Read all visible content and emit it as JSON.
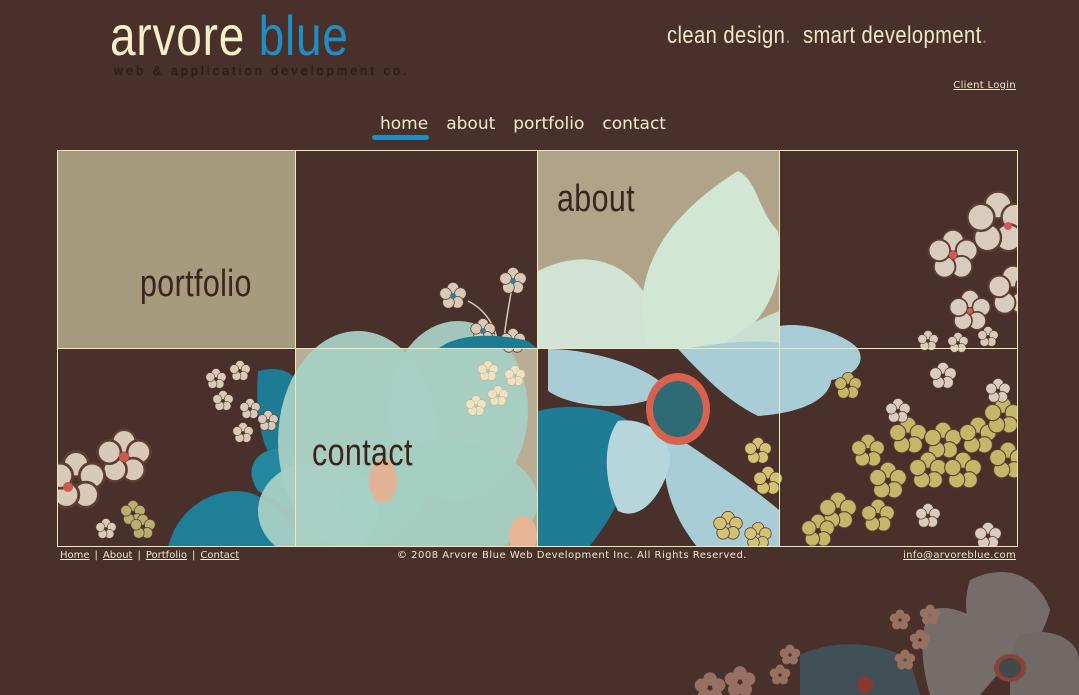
{
  "header": {
    "logo": {
      "word1": "arvore",
      "word2": "blue",
      "subtitle": "web & application development co."
    },
    "tagline": {
      "part1": "clean design",
      "part2": "smart development",
      "dot": "."
    },
    "client_login": "Client Login"
  },
  "nav": {
    "items": [
      {
        "label": "home",
        "active": true
      },
      {
        "label": "about",
        "active": false
      },
      {
        "label": "portfolio",
        "active": false
      },
      {
        "label": "contact",
        "active": false
      }
    ]
  },
  "grid": {
    "tiles": [
      {
        "label": "portfolio"
      },
      {
        "label": "about"
      },
      {
        "label": "contact"
      }
    ]
  },
  "footer": {
    "links": [
      "Home",
      "About",
      "Portfolio",
      "Contact"
    ],
    "separator": "|",
    "copyright": "© 2008 Arvore Blue Web Development Inc. All Rights Reserved.",
    "email": "info@arvoreblue.com"
  },
  "colors": {
    "background": "#4a302a",
    "accent_blue": "#1d8fc6",
    "cream": "#f5efc8",
    "tile_tan": "#a69b7e",
    "label_brown": "#3b241d"
  }
}
